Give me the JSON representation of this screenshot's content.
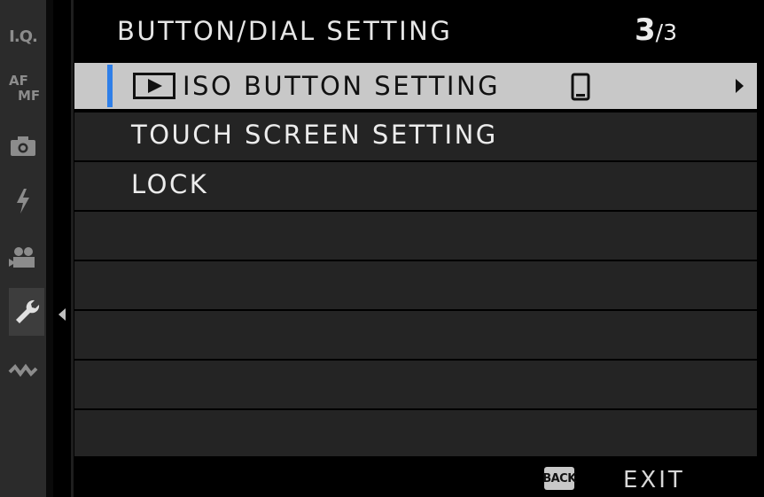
{
  "header": {
    "title": "BUTTON/DIAL SETTING",
    "page_current": "3",
    "page_sep": "/",
    "page_total": "3"
  },
  "sidebar": {
    "items": [
      {
        "label": "I.Q.",
        "icon": "image-quality-icon"
      },
      {
        "label": "AF\nMF",
        "icon": "af-mf-icon"
      },
      {
        "label": "",
        "icon": "camera-icon"
      },
      {
        "label": "",
        "icon": "flash-icon"
      },
      {
        "label": "",
        "icon": "movie-icon"
      },
      {
        "label": "",
        "icon": "wrench-icon",
        "active": true
      },
      {
        "label": "",
        "icon": "connection-icon"
      }
    ]
  },
  "menu": {
    "items": [
      {
        "label": "ISO BUTTON SETTING",
        "selected": true
      },
      {
        "label": "TOUCH SCREEN SETTING"
      },
      {
        "label": "LOCK"
      },
      {
        "label": ""
      },
      {
        "label": ""
      },
      {
        "label": ""
      },
      {
        "label": ""
      },
      {
        "label": ""
      }
    ]
  },
  "footer": {
    "back_label": "BACK",
    "exit_label": "EXIT"
  },
  "colors": {
    "accent": "#2f7fe8",
    "selection": "#c8c8c8",
    "row": "#242424"
  }
}
